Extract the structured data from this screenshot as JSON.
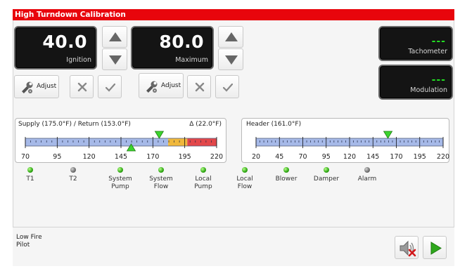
{
  "title": "High Turndown Calibration",
  "ignition": {
    "value": "40.0",
    "label": "Ignition"
  },
  "maximum": {
    "value": "80.0",
    "label": "Maximum"
  },
  "tachometer": {
    "value": "---",
    "label": "Tachometer"
  },
  "modulation": {
    "value": "---",
    "label": "Modulation"
  },
  "adjust_label": "Adjust",
  "gauge_supply": {
    "label": "Supply (175.0°F) / Return (153.0°F)",
    "delta": "Δ (22.0°F)",
    "ticks": [
      "70",
      "95",
      "120",
      "145",
      "170",
      "195",
      "220"
    ],
    "range": [
      70,
      220
    ],
    "supply": 175.0,
    "return": 153.0
  },
  "gauge_header": {
    "label": "Header (161.0°F)",
    "ticks": [
      "20",
      "45",
      "70",
      "95",
      "120",
      "145",
      "170",
      "195",
      "220"
    ],
    "range": [
      20,
      220
    ],
    "value": 161.0
  },
  "indicators": [
    {
      "name": "T1",
      "state": "on"
    },
    {
      "name": "T2",
      "state": "off"
    },
    {
      "name": "System\nPump",
      "state": "on"
    },
    {
      "name": "System\nFlow",
      "state": "on"
    },
    {
      "name": "Local\nPump",
      "state": "on"
    },
    {
      "name": "Local\nFlow",
      "state": "on"
    },
    {
      "name": "Blower",
      "state": "on"
    },
    {
      "name": "Damper",
      "state": "on"
    },
    {
      "name": "Alarm",
      "state": "off"
    }
  ],
  "status_line1": "Low Fire",
  "status_line2": "Pilot",
  "colors": {
    "titlebar": "#e8050c",
    "accent_green": "#22dd22",
    "gauge_blue": "#a6b9e8",
    "gauge_orange": "#f0b83c",
    "gauge_red": "#e2474a"
  }
}
